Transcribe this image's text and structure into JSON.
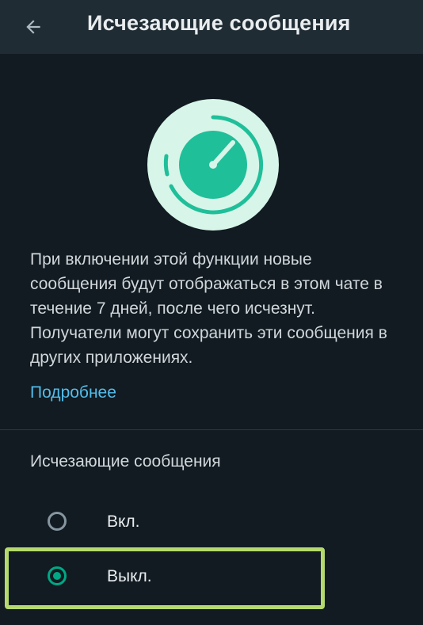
{
  "appbar": {
    "back_icon": "arrow-left-icon",
    "title": "Исчезающие сообщения"
  },
  "hero": {
    "icon": "timer-icon",
    "background_color": "#d7f5e8",
    "accent_color": "#1fbf9a"
  },
  "description": {
    "text": "При включении этой функции новые сообщения будут отображаться в этом чате в течение 7 дней, после чего исчезнут. Получатели могут сохранить эти сообщения в других приложениях.",
    "link": "Подробнее"
  },
  "settings": {
    "section_title": "Исчезающие сообщения",
    "options": [
      {
        "label": "Вкл.",
        "selected": false
      },
      {
        "label": "Выкл.",
        "selected": true
      }
    ]
  },
  "colors": {
    "background": "#111b21",
    "appbar": "#202c33",
    "accent": "#00a884",
    "link": "#53bdeb",
    "highlight_frame": "#b5d96e"
  }
}
